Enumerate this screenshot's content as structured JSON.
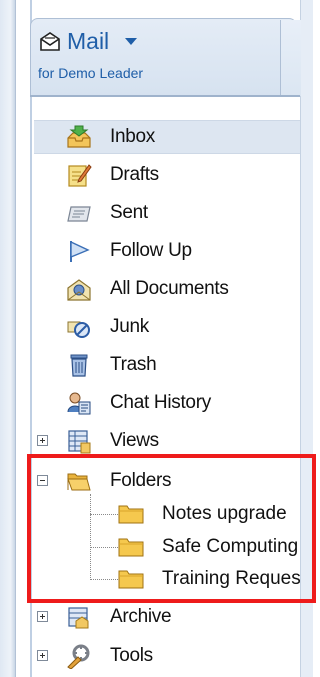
{
  "app": {
    "title": "Mail",
    "subtitle": "for Demo Leader",
    "icon": "mail-envelope-icon"
  },
  "nav": {
    "items": [
      {
        "label": "Inbox",
        "icon": "inbox-icon",
        "selected": true
      },
      {
        "label": "Drafts",
        "icon": "drafts-icon"
      },
      {
        "label": "Sent",
        "icon": "sent-icon"
      },
      {
        "label": "Follow Up",
        "icon": "follow-up-flag-icon"
      },
      {
        "label": "All Documents",
        "icon": "all-documents-icon"
      },
      {
        "label": "Junk",
        "icon": "junk-icon"
      },
      {
        "label": "Trash",
        "icon": "trash-icon"
      },
      {
        "label": "Chat History",
        "icon": "chat-history-icon"
      },
      {
        "label": "Views",
        "icon": "views-icon",
        "expander": "collapsed"
      },
      {
        "label": "Folders",
        "icon": "folder-open-icon",
        "expander": "expanded"
      },
      {
        "label": "Archive",
        "icon": "archive-icon",
        "expander": "collapsed"
      },
      {
        "label": "Tools",
        "icon": "tools-icon",
        "expander": "collapsed"
      }
    ],
    "folders": [
      {
        "label": "Notes upgrade",
        "icon": "folder-icon"
      },
      {
        "label": "Safe Computing",
        "icon": "folder-icon"
      },
      {
        "label": "Training Requests",
        "icon": "folder-icon"
      }
    ]
  },
  "colors": {
    "accent": "#1f5ea8",
    "highlight_box": "#ee1b1b",
    "selected_row": "#dde6f1"
  }
}
